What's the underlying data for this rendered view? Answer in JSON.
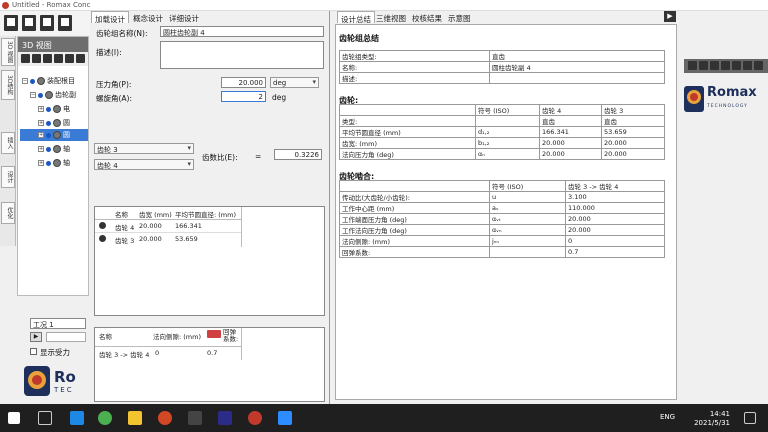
{
  "window": {
    "title": "Untitled - Romax Conc"
  },
  "tree": {
    "header": "3D 视图",
    "nodes": [
      {
        "label": "装配根目",
        "indent": 0,
        "selected": false
      },
      {
        "label": "齿轮副",
        "indent": 1,
        "selected": false
      },
      {
        "label": "电",
        "indent": 2,
        "selected": false
      },
      {
        "label": "圆",
        "indent": 2,
        "selected": false
      },
      {
        "label": "圆",
        "indent": 2,
        "selected": true
      },
      {
        "label": "轴",
        "indent": 1,
        "selected": false
      },
      {
        "label": "轴",
        "indent": 1,
        "selected": false
      }
    ]
  },
  "vtabs": [
    "3D 视图",
    "3D结构",
    "插入",
    "设计",
    "优化"
  ],
  "loadcase": {
    "label": "工况 1",
    "checkbox_label": "显示受力"
  },
  "logo": {
    "brand": "Ro",
    "sub": "TEC"
  },
  "center": {
    "tabs": [
      "加载设计",
      "概念设计",
      "详细设计"
    ],
    "name_label": "齿轮组名称(N):",
    "name_value": "圆柱齿轮副 4",
    "desc_label": "描述(I):",
    "pressure_label": "压力角(P):",
    "pressure_value": "20.000",
    "pressure_unit": "deg",
    "helix_label": "螺旋角(A):",
    "helix_value": "2",
    "helix_unit": "deg",
    "gear_a": "齿轮 3",
    "gear_b": "齿轮 4",
    "ratio_label": "齿数比(E):",
    "ratio_eq": "=",
    "ratio_value": "0.3226",
    "gear_table": {
      "headers": [
        "名称",
        "齿宽 (mm)",
        "平均节圆直径: (mm)"
      ],
      "rows": [
        [
          "齿轮 4",
          "20.000",
          "166.341"
        ],
        [
          "齿轮 3",
          "20.000",
          "53.659"
        ]
      ]
    },
    "mesh_table": {
      "headers": [
        "名称",
        "法向侧隙: (mm)",
        "回弹系数:"
      ],
      "rows": [
        [
          "齿轮 3 -> 齿轮 4",
          "0",
          "0.7"
        ]
      ]
    }
  },
  "right": {
    "tabs": [
      "设计总结",
      "三维视图",
      "校核结果",
      "示意图"
    ],
    "title": "齿轮组总结",
    "summary": [
      [
        "齿轮组类型:",
        "直齿"
      ],
      [
        "名称:",
        "圆柱齿轮副 4"
      ],
      [
        "描述:",
        ""
      ]
    ],
    "gear_section": "齿轮:",
    "gear_headers": [
      "",
      "符号 (ISO)",
      "齿轮 4",
      "齿轮 3"
    ],
    "gear_rows": [
      [
        "类型:",
        "",
        "直齿",
        "直齿"
      ],
      [
        "平均节圆直径 (mm)",
        "d₁,₂",
        "166.341",
        "53.659"
      ],
      [
        "齿宽: (mm)",
        "b₁,₂",
        "20.000",
        "20.000"
      ],
      [
        "法向压力角 (deg)",
        "αₙ",
        "20.000",
        "20.000"
      ]
    ],
    "mesh_section": "齿轮啮合:",
    "mesh_headers": [
      "",
      "符号 (ISO)",
      "齿轮 3 -> 齿轮 4"
    ],
    "mesh_rows": [
      [
        "传动比(大齿轮/小齿轮):",
        "u",
        "3.100"
      ],
      [
        "工作中心距 (mm)",
        "aᵥ",
        "110.000"
      ],
      [
        "工作端面压力角 (deg)",
        "αᵥₜ",
        "20.000"
      ],
      [
        "工作法向压力角 (deg)",
        "αᵥₙ",
        "20.000"
      ],
      [
        "法向侧隙: (mm)",
        "jₙₙ",
        "0"
      ],
      [
        "回弹系数:",
        "",
        "0.7"
      ]
    ]
  },
  "farright": {
    "brand": "Romax",
    "sub": "TECHNOLOGY"
  },
  "taskbar": {
    "lang": "ENG",
    "time": "14:41",
    "date": "2021/5/31"
  }
}
